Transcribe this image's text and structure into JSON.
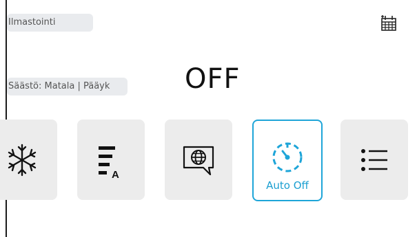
{
  "header": {
    "mode_label": "Ilmastointi",
    "schedule_icon": "calendar-grid-icon"
  },
  "info": {
    "saving_label": "Säästö: Matala | Pääyk"
  },
  "power": {
    "status": "OFF"
  },
  "controls": [
    {
      "icon": "snowflake-icon",
      "label": ""
    },
    {
      "icon": "fan-speed-auto-icon",
      "label": ""
    },
    {
      "icon": "language-globe-icon",
      "label": ""
    },
    {
      "icon": "timer-icon",
      "label": "Auto Off",
      "selected": true
    },
    {
      "icon": "menu-list-icon",
      "label": ""
    }
  ],
  "colors": {
    "accent": "#1ea5d8",
    "tile_bg": "#ececec",
    "pill_bg": "#e9ebee"
  }
}
